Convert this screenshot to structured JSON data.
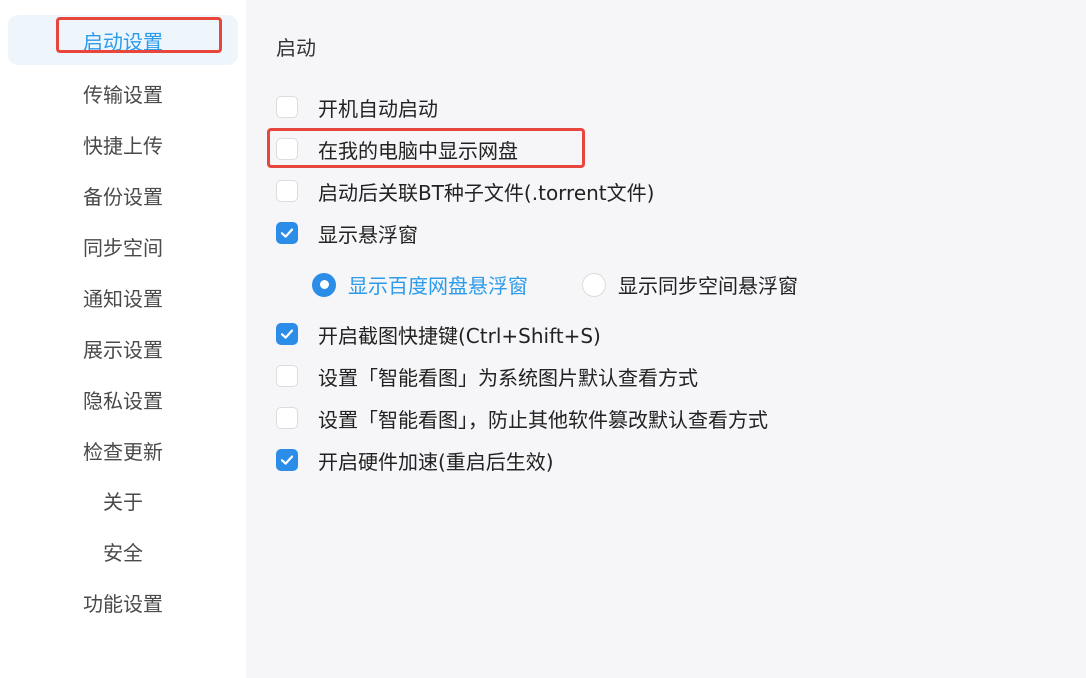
{
  "sidebar": {
    "items": [
      {
        "label": "启动设置"
      },
      {
        "label": "传输设置"
      },
      {
        "label": "快捷上传"
      },
      {
        "label": "备份设置"
      },
      {
        "label": "同步空间"
      },
      {
        "label": "通知设置"
      },
      {
        "label": "展示设置"
      },
      {
        "label": "隐私设置"
      },
      {
        "label": "检查更新"
      },
      {
        "label": "关于"
      },
      {
        "label": "安全"
      },
      {
        "label": "功能设置"
      }
    ],
    "active_index": 0
  },
  "main": {
    "section_title": "启动",
    "options": [
      {
        "label": "开机自动启动",
        "checked": false
      },
      {
        "label": "在我的电脑中显示网盘",
        "checked": false
      },
      {
        "label": "启动后关联BT种子文件(.torrent文件)",
        "checked": false
      },
      {
        "label": "显示悬浮窗",
        "checked": true
      },
      {
        "label": "开启截图快捷键(Ctrl+Shift+S)",
        "checked": true
      },
      {
        "label": "设置「智能看图」为系统图片默认查看方式",
        "checked": false
      },
      {
        "label": "设置「智能看图」，防止其他软件篡改默认查看方式",
        "checked": false
      },
      {
        "label": "开启硬件加速(重启后生效)",
        "checked": true
      }
    ],
    "float_radio": [
      {
        "label": "显示百度网盘悬浮窗",
        "selected": true
      },
      {
        "label": "显示同步空间悬浮窗",
        "selected": false
      }
    ]
  },
  "colors": {
    "accent": "#2b8de8",
    "annotation": "#e8453c"
  }
}
